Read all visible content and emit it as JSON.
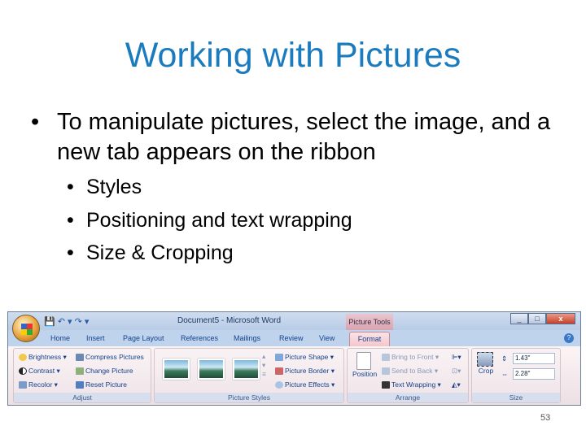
{
  "slide": {
    "title": "Working with Pictures",
    "bullet": "To manipulate pictures, select the image, and a new tab appears on the ribbon",
    "subbullets": [
      "Styles",
      "Positioning and text wrapping",
      "Size & Cropping"
    ],
    "bullet_char": "•",
    "page_number": "53"
  },
  "window": {
    "title": "Document5 - Microsoft Word",
    "context_tab": "Picture Tools",
    "buttons": [
      "_",
      "□",
      "x"
    ],
    "help": "?"
  },
  "tabs": [
    "Home",
    "Insert",
    "Page Layout",
    "References",
    "Mailings",
    "Review",
    "View",
    "Format"
  ],
  "adjust": {
    "label": "Adjust",
    "items": [
      "Brightness ▾",
      "Contrast ▾",
      "Recolor ▾",
      "Compress Pictures",
      "Change Picture",
      "Reset Picture"
    ]
  },
  "styles": {
    "label": "Picture Styles",
    "items": [
      "Picture Shape ▾",
      "Picture Border ▾",
      "Picture Effects ▾"
    ]
  },
  "arrange": {
    "label": "Arrange",
    "position": "Position",
    "items": [
      "Bring to Front ▾",
      "Send to Back ▾",
      "Text Wrapping ▾"
    ]
  },
  "size": {
    "label": "Size",
    "crop": "Crop",
    "height": "1.43\"",
    "width": "2.28\""
  },
  "colors": {
    "title": "#1a7bbf",
    "ribbon": "#c9d9ee",
    "format_tab": "#f4c6cc"
  }
}
